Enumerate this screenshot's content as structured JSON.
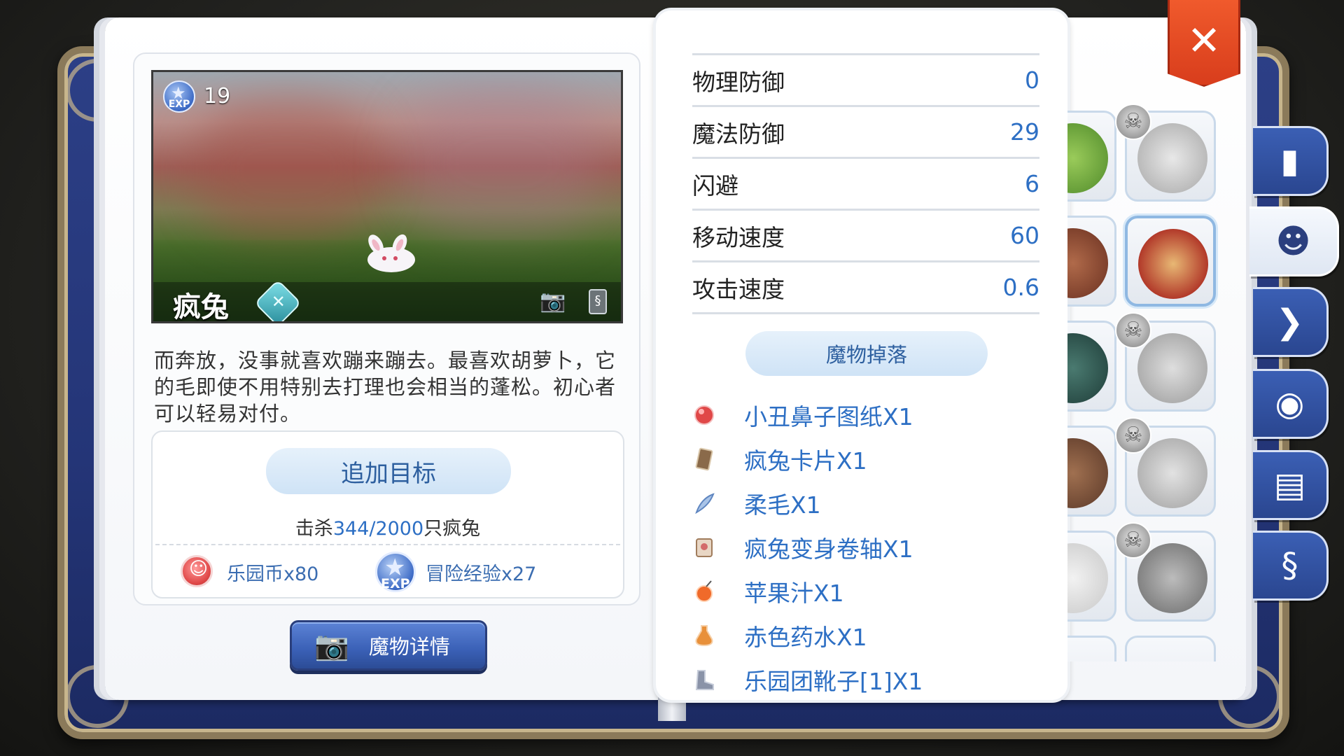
{
  "monster": {
    "name": "疯兔",
    "exp": "19",
    "description": "而奔放，没事就喜欢蹦来蹦去。最喜欢胡萝卜，它的毛即使不用特别去打理也会相当的蓬松。初心者可以轻易对付。"
  },
  "target": {
    "button_label": "追加目标",
    "kill_prefix": "击杀",
    "kill_progress": "344/2000",
    "kill_suffix": "只疯兔",
    "rewards": [
      {
        "icon": "park-coin-icon",
        "label": "乐园币x80"
      },
      {
        "icon": "exp-icon",
        "label": "冒险经验x27"
      }
    ]
  },
  "detail_button": {
    "label": "魔物详情",
    "icon": "camera-icon"
  },
  "stats": [
    {
      "label": "物理防御",
      "value": "0"
    },
    {
      "label": "魔法防御",
      "value": "29"
    },
    {
      "label": "闪避",
      "value": "6"
    },
    {
      "label": "移动速度",
      "value": "60"
    },
    {
      "label": "攻击速度",
      "value": "0.6"
    }
  ],
  "drops": {
    "header": "魔物掉落",
    "items": [
      {
        "label": "小丑鼻子图纸X1",
        "icon": "red-nose-icon",
        "color": "#e04848"
      },
      {
        "label": "疯兔卡片X1",
        "icon": "card-icon",
        "color": "#8a6a4a"
      },
      {
        "label": "柔毛X1",
        "icon": "feather-icon",
        "color": "#7fa6d8"
      },
      {
        "label": "疯兔变身卷轴X1",
        "icon": "scroll-icon",
        "color": "#c9a78a"
      },
      {
        "label": "苹果汁X1",
        "icon": "apple-juice-icon",
        "color": "#f06a2a"
      },
      {
        "label": "赤色药水X1",
        "icon": "red-potion-icon",
        "color": "#e8903a"
      },
      {
        "label": "乐园团靴子[1]X1",
        "icon": "boots-icon",
        "color": "#8a93a8"
      }
    ]
  },
  "tabs": [
    {
      "name": "tab-book",
      "icon": "book-icon",
      "glyph": "▮"
    },
    {
      "name": "tab-monster",
      "icon": "monster-face-icon",
      "glyph": "☻"
    },
    {
      "name": "tab-hunt",
      "icon": "claw-icon",
      "glyph": "❯"
    },
    {
      "name": "tab-npc",
      "icon": "npc-head-icon",
      "glyph": "◉"
    },
    {
      "name": "tab-album",
      "icon": "open-book-icon",
      "glyph": "▤"
    },
    {
      "name": "tab-card",
      "icon": "card-icon",
      "glyph": "§"
    }
  ],
  "close_label": "✕",
  "colors": {
    "accent": "#2d6fc4",
    "cover": "#2c3f86",
    "close": "#e04a22"
  }
}
